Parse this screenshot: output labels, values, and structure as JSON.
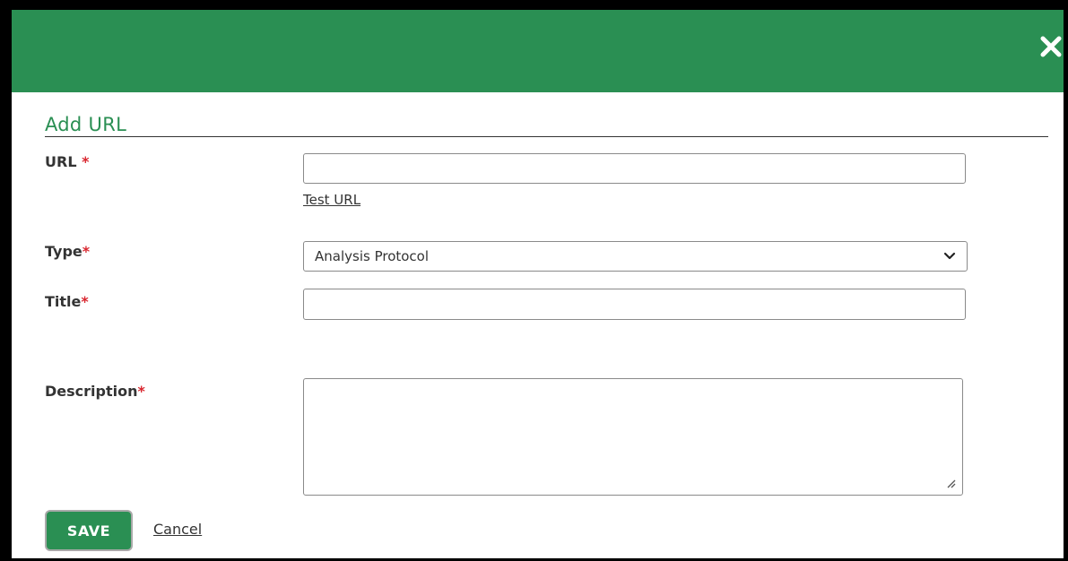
{
  "dialog": {
    "title": "Add URL",
    "close_icon": "close-icon",
    "header_color": "#2a8f53"
  },
  "form": {
    "url": {
      "label": "URL",
      "required_mark": "*",
      "value": ""
    },
    "test_url_link": "Test URL",
    "type": {
      "label": "Type",
      "required_mark": "*",
      "selected": "Analysis Protocol"
    },
    "title": {
      "label": "Title",
      "required_mark": "*",
      "value": ""
    },
    "description": {
      "label": "Description",
      "required_mark": "*",
      "value": ""
    }
  },
  "actions": {
    "save_label": "SAVE",
    "cancel_label": "Cancel"
  },
  "colors": {
    "accent": "#2a8f53",
    "required": "#d9262f"
  }
}
